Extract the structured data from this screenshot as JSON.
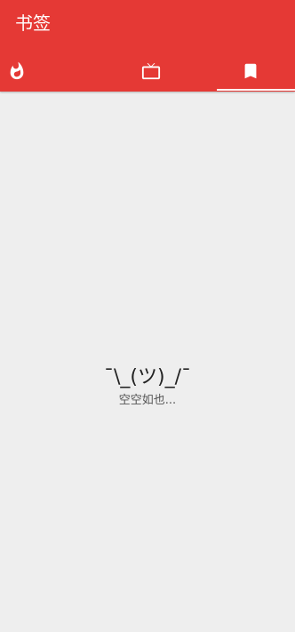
{
  "header": {
    "title": "书签"
  },
  "tabs": [
    {
      "icon": "flame-icon",
      "selected": false
    },
    {
      "icon": "tv-icon",
      "selected": false
    },
    {
      "icon": "bookmark-icon",
      "selected": true
    }
  ],
  "empty_state": {
    "emoticon": "¯\\_(ツ)_/¯",
    "message": "空空如也..."
  },
  "colors": {
    "primary": "#e53935",
    "background": "#eeeeee",
    "on_primary": "#ffffff"
  }
}
